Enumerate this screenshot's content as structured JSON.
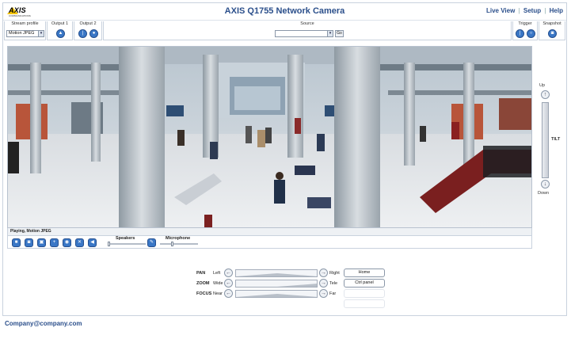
{
  "app": {
    "brand": "AXIS",
    "brand_sub": "COMMUNICATIONS",
    "title": "AXIS Q1755 Network Camera"
  },
  "nav": {
    "live_view": "Live View",
    "setup": "Setup",
    "help": "Help",
    "separator": "|"
  },
  "controls": {
    "stream_profile_label": "Stream profile",
    "stream_profile_value": "Motion JPEG",
    "output1_label": "Output 1",
    "output2_label": "Output 2",
    "source_label": "Source",
    "source_value": "",
    "go_label": "Go",
    "trigger_label": "Trigger",
    "snapshot_label": "Snapshot"
  },
  "video": {
    "status_text": "Playing, Motion JPEG"
  },
  "video_toolbar": {
    "speakers_label": "Speakers",
    "microphone_label": "Microphone",
    "speakers_level": 0.0,
    "microphone_level": 0.3
  },
  "tilt": {
    "up_label": "Up",
    "down_label": "Down",
    "title": "TILT"
  },
  "ptz": {
    "pan": {
      "label": "PAN",
      "min": "Left",
      "max": "Right"
    },
    "zoom": {
      "label": "ZOOM",
      "min": "Wide",
      "max": "Tele"
    },
    "focus": {
      "label": "FOCUS",
      "min": "Near",
      "max": "Far"
    },
    "home_label": "Home",
    "ctrl_panel_label": "Ctrl panel"
  },
  "footer": {
    "email": "Company@company.com"
  },
  "colors": {
    "accent": "#2b4f8b",
    "button": "#3a77c6",
    "border": "#c9d2de"
  }
}
